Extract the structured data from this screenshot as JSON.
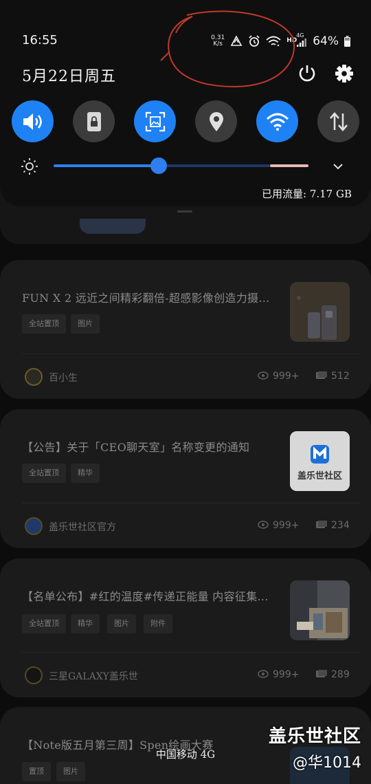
{
  "status_bar": {
    "time": "16:55",
    "net_speed_value": "0.31",
    "net_speed_unit": "K/s",
    "network_label_top": "HD",
    "network_label_gen": "4G",
    "battery": "64%"
  },
  "shade": {
    "date": "5月22日周五",
    "quick_settings": [
      {
        "name": "sound",
        "state": "on"
      },
      {
        "name": "lock-rotation",
        "state": "off"
      },
      {
        "name": "screenshot",
        "state": "on"
      },
      {
        "name": "location",
        "state": "off"
      },
      {
        "name": "wifi",
        "state": "on"
      },
      {
        "name": "mobile-data",
        "state": "off"
      }
    ],
    "brightness_level": 0.42,
    "data_usage": "已用流量: 7.17 GB"
  },
  "feed": {
    "posts": [
      {
        "title": "FUN X 2 远近之间精彩翻倍-超感影像创造力摄...",
        "tags": [
          "全站置顶",
          "图片"
        ],
        "author": "百小生",
        "views": "999+",
        "comments": "512"
      },
      {
        "title": "【公告】关于「CEO聊天室」名称变更的通知",
        "tags": [
          "全站置顶",
          "精华"
        ],
        "author": "盖乐世社区官方",
        "views": "999+",
        "comments": "234",
        "thumb_text": "盖乐世社区"
      },
      {
        "title": "【名单公布】#红的温度#传递正能量 内容征集...",
        "tags": [
          "全站置顶",
          "精华",
          "图片",
          "附件"
        ],
        "author": "三星GALAXY盖乐世",
        "views": "999+",
        "comments": "289"
      },
      {
        "title": "【Note版五月第三周】Spen绘画大赛",
        "tags": [
          "置顶",
          "图片"
        ]
      }
    ]
  },
  "carrier": "中国移动 4G",
  "watermark": {
    "line1": "盖乐世社区",
    "line2": "@华1014"
  },
  "colors": {
    "accent": "#1e82f5",
    "annotation": "#c0392b"
  }
}
